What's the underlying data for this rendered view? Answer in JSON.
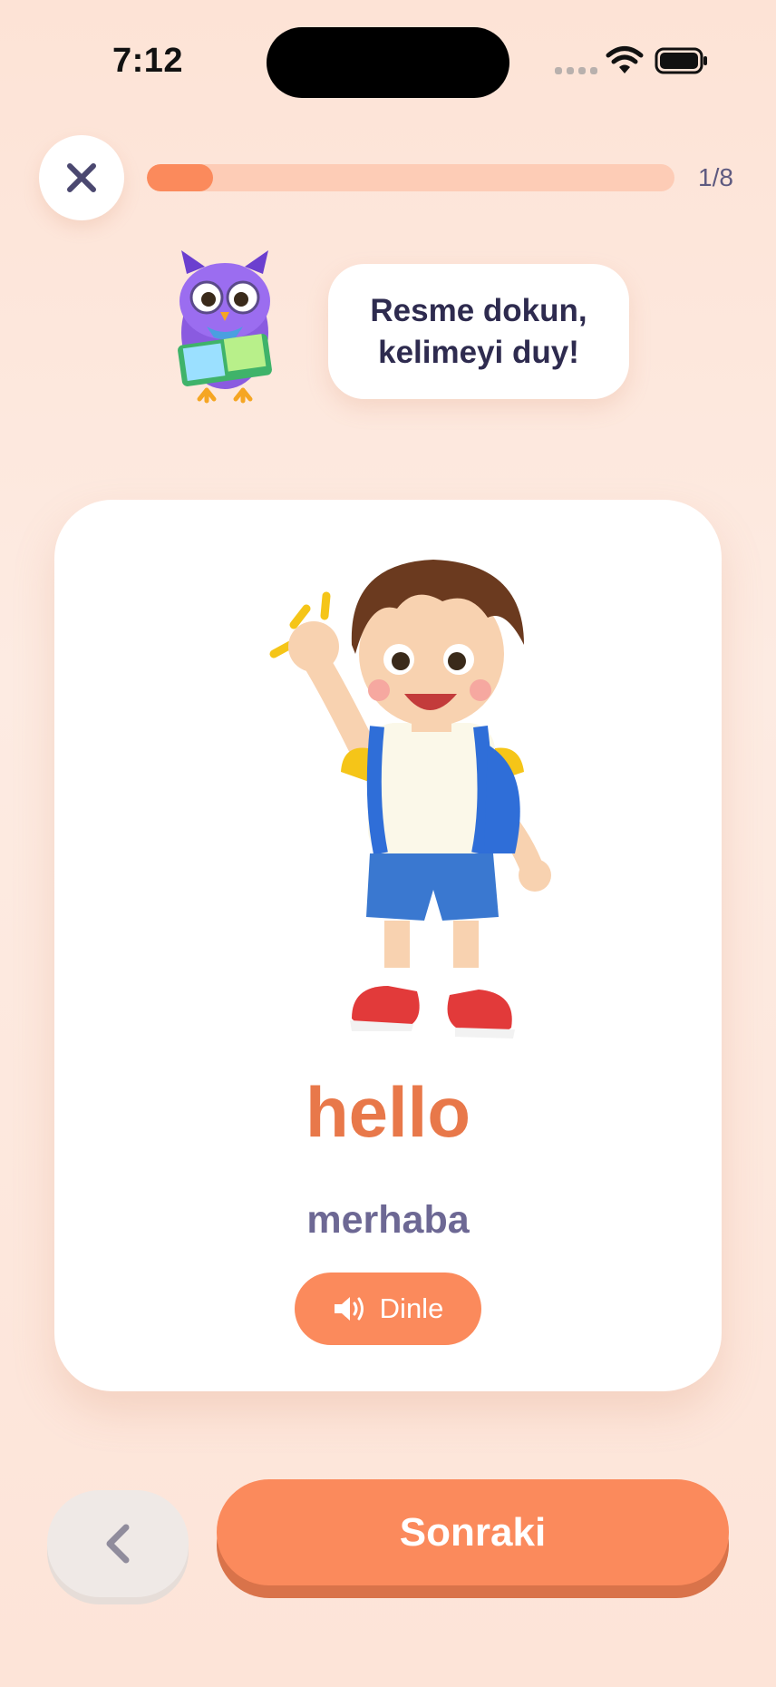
{
  "status_bar": {
    "time": "7:12"
  },
  "header": {
    "progress_text": "1/8",
    "progress_fraction": 0.125
  },
  "mascot": {
    "speech": "Resme dokun, kelimeyi duy!"
  },
  "card": {
    "word": "hello",
    "translation": "merhaba",
    "listen_label": "Dinle"
  },
  "footer": {
    "next_label": "Sonraki"
  },
  "colors": {
    "accent": "#fb8a5c",
    "word": "#e8784a",
    "translation": "#6d6894",
    "background": "#fde3d6"
  },
  "icons": {
    "close": "close-icon",
    "speaker": "speaker-icon",
    "back": "chevron-left-icon",
    "wifi": "wifi-icon",
    "battery": "battery-icon"
  }
}
